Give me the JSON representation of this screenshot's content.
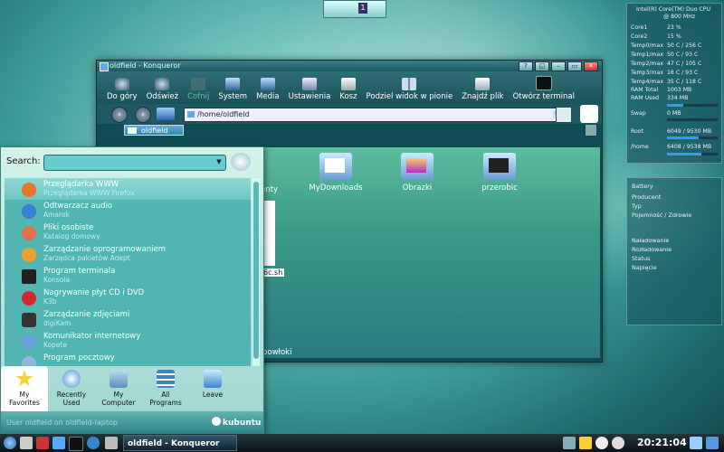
{
  "colors": {
    "accent": "#2f6e75",
    "selection": "#8fd8d6",
    "menu_bg": "#d4f2ea",
    "view_bg": "#3a9a86",
    "bar_fill": "#3399ff"
  },
  "pager": {
    "label": "1"
  },
  "window": {
    "title": "oldfield - Konqueror",
    "buttons": [
      "?",
      "◱",
      "–",
      "▭",
      "✕"
    ],
    "toolbar": [
      {
        "label": "Do góry",
        "icon": "up-arrow-icon",
        "enabled": true
      },
      {
        "label": "Odśwież",
        "icon": "reload-icon",
        "enabled": true
      },
      {
        "label": "Cofnij",
        "icon": "undo-icon",
        "enabled": false
      },
      {
        "label": "System",
        "icon": "system-icon",
        "enabled": true
      },
      {
        "label": "Media",
        "icon": "media-icon",
        "enabled": true
      },
      {
        "label": "Ustawienia",
        "icon": "settings-icon",
        "enabled": true
      },
      {
        "label": "Kosz",
        "icon": "trash-icon",
        "enabled": true
      },
      {
        "label": "Podziel widok w pionie",
        "icon": "split-view-icon",
        "enabled": true
      },
      {
        "label": "Znajdź plik",
        "icon": "find-file-icon",
        "enabled": true
      },
      {
        "label": "Otwórz terminal",
        "icon": "terminal-icon",
        "enabled": true
      }
    ],
    "location": "/home/oldfield",
    "tab": "oldfield",
    "items": [
      {
        "label": "MyDownloads",
        "icon": "folder-downloads-icon"
      },
      {
        "label": "Obrazki",
        "icon": "folder-images-icon"
      },
      {
        "label": "przerobic",
        "icon": "folder-terminal-icon"
      }
    ],
    "partial_labels": {
      "enty": "enty",
      "sh": "6c.sh",
      "powloki": "powłoki"
    }
  },
  "kmenu": {
    "search_label": "Search:",
    "search_value": "",
    "apps": [
      {
        "title": "Przeglądarka WWW",
        "subtitle": "Przeglądarka WWW Firefox",
        "icon": "firefox-icon",
        "color": "#e8752a",
        "selected": true
      },
      {
        "title": "Odtwarzacz audio",
        "subtitle": "Amarok",
        "icon": "amarok-icon",
        "color": "#3a7fd0",
        "selected": false
      },
      {
        "title": "Pliki osobiste",
        "subtitle": "Katalog domowy",
        "icon": "home-folder-icon",
        "color": "#e07050",
        "selected": false
      },
      {
        "title": "Zarządzanie oprogramowaniem",
        "subtitle": "Zarządca pakietów Adept",
        "icon": "adept-icon",
        "color": "#e8a030",
        "selected": false
      },
      {
        "title": "Program terminala",
        "subtitle": "Konsola",
        "icon": "konsole-icon",
        "color": "#222222",
        "selected": false
      },
      {
        "title": "Nagrywanie płyt CD i DVD",
        "subtitle": "K3b",
        "icon": "k3b-icon",
        "color": "#d02a2a",
        "selected": false
      },
      {
        "title": "Zarządzanie zdjęciami",
        "subtitle": "digiKam",
        "icon": "digikam-icon",
        "color": "#333333",
        "selected": false
      },
      {
        "title": "Komunikator internetowy",
        "subtitle": "Kopete",
        "icon": "kopete-icon",
        "color": "#6aa0e0",
        "selected": false
      },
      {
        "title": "Program pocztowy",
        "subtitle": "",
        "icon": "mail-icon",
        "color": "#8fb8d8",
        "selected": false
      }
    ],
    "tabs": [
      {
        "label_1": "My",
        "label_2": "Favorites",
        "icon": "star-icon",
        "color": "#f2d23a",
        "active": true
      },
      {
        "label_1": "Recently Used",
        "label_2": "",
        "icon": "clock-icon",
        "color": "#4a90d0",
        "active": false
      },
      {
        "label_1": "My",
        "label_2": "Computer",
        "icon": "computer-icon",
        "color": "#5a8fc0",
        "active": false
      },
      {
        "label_1": "All",
        "label_2": "Programs",
        "icon": "programs-icon",
        "color": "#3f84c8",
        "active": false
      },
      {
        "label_1": "Leave",
        "label_2": "",
        "icon": "leave-icon",
        "color": "#3a86c8",
        "active": false
      }
    ],
    "footer_user": "User oldfield on oldfield-laptop",
    "footer_brand": "kubuntu"
  },
  "cpu_monitor": {
    "cpu_name": "Intel(R) Core(TM) Duo CPU",
    "cpu_freq": "@ 800 MHz",
    "rows": [
      {
        "label": "Core1",
        "value": "23 %"
      },
      {
        "label": "Core2",
        "value": "15 %"
      },
      {
        "label": "Temp0/max",
        "value": "50 C  /  256 C"
      },
      {
        "label": "Temp1/max",
        "value": "50 C  /  93 C"
      },
      {
        "label": "Temp2/max",
        "value": "47 C  /  105 C"
      },
      {
        "label": "Temp3/max",
        "value": "16 C  /  93 C"
      },
      {
        "label": "Temp4/max",
        "value": "35 C  /  118 C"
      },
      {
        "label": "RAM Total",
        "value": "1003 MB"
      },
      {
        "label": "RAM Used",
        "value": "334 MB"
      },
      {
        "label": "Swap",
        "value": "0 MB"
      },
      {
        "label": "Root",
        "value": "6049 / 9530 MB"
      },
      {
        "label": "/home",
        "value": "6408 / 9538 MB"
      }
    ],
    "usage": {
      "ram": 0.33,
      "swap": 0.0,
      "root": 0.63,
      "home": 0.67
    }
  },
  "battery": {
    "title": "Battery",
    "rows_top": [
      "Producent",
      "Typ",
      "Pojemność / Zdrowie"
    ],
    "rows_bottom": [
      "Naładowanie",
      "Rozładowanie",
      "Status",
      "Napięcie"
    ]
  },
  "taskbar": {
    "task_label": "oldfield - Konqueror",
    "clock": "20:21:04"
  }
}
